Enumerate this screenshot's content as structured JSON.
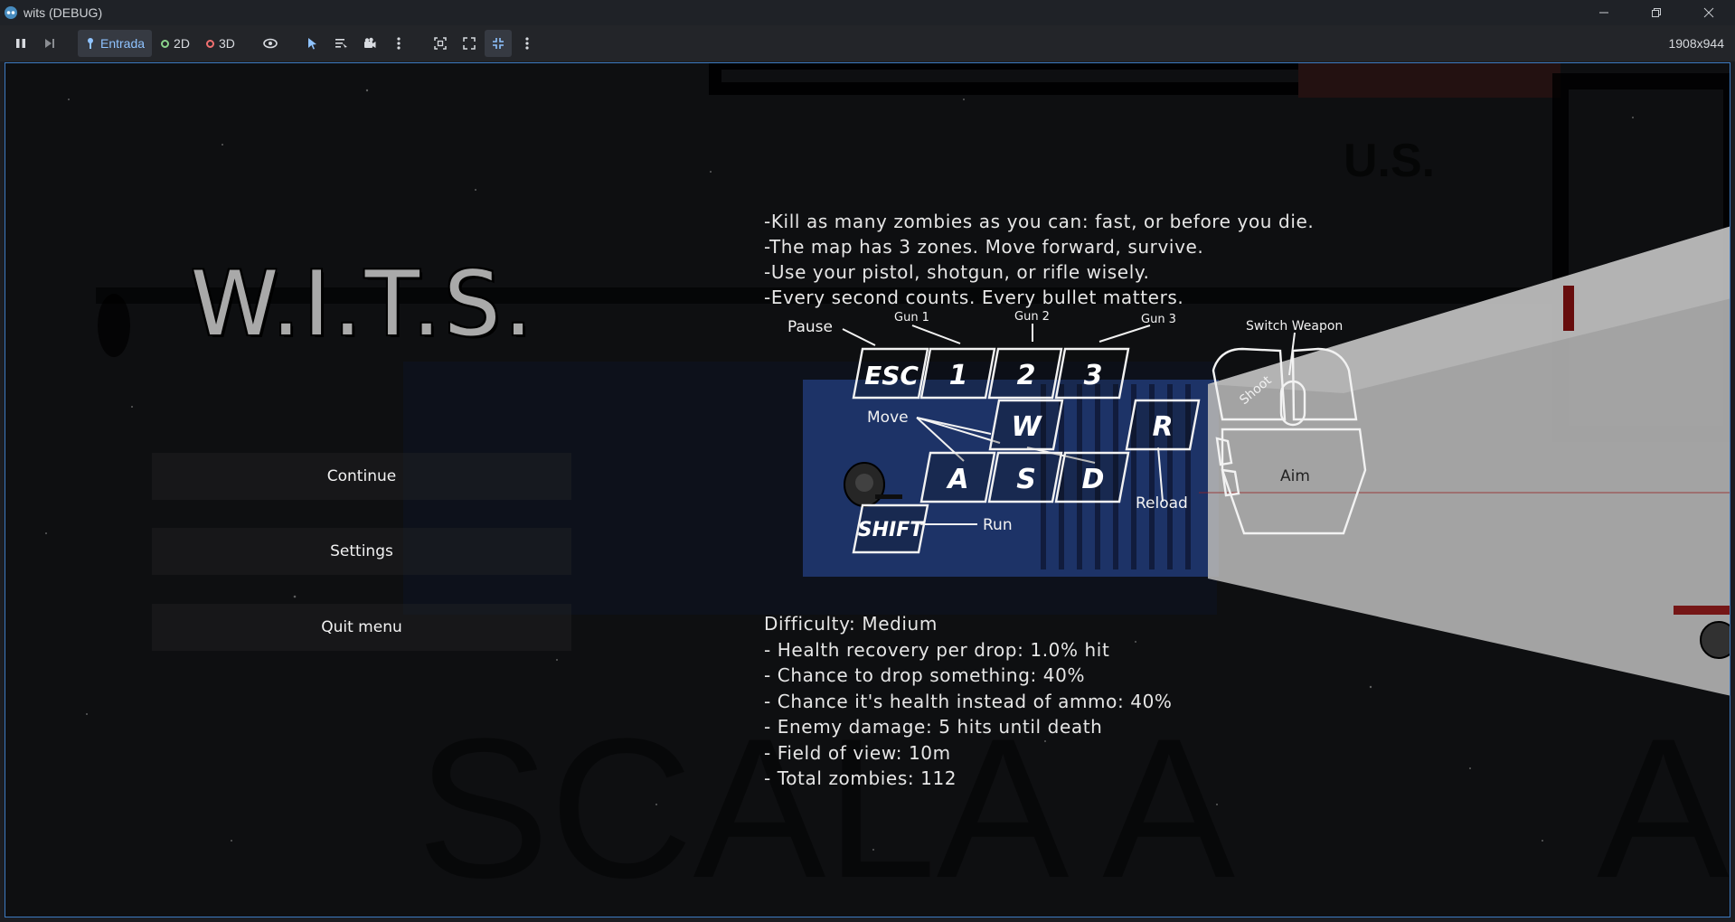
{
  "window": {
    "title": "wits (DEBUG)",
    "icon": "godot-icon",
    "controls": [
      "minimize-icon",
      "restore-icon",
      "close-icon"
    ]
  },
  "toolbar": {
    "pause_icon": "pause-icon",
    "next_frame_icon": "next-frame-icon",
    "tabs": [
      {
        "label": "Entrada",
        "icon": "input-icon",
        "active": true
      },
      {
        "label": "2D",
        "icon": "circle-2d-icon",
        "color": "#8bd48b"
      },
      {
        "label": "3D",
        "icon": "circle-3d-icon",
        "color": "#f07070"
      }
    ],
    "resolution": "1908x944"
  },
  "game": {
    "title": "W.I.T.S.",
    "menu": {
      "continue": "Continue",
      "settings": "Settings",
      "quit": "Quit menu"
    },
    "objectives": [
      "-Kill as many zombies as you can:  fast, or before you die.",
      "-The map has 3 zones. Move forward, survive.",
      "-Use your pistol, shotgun, or rifle wisely.",
      "-Every second counts. Every bullet matters."
    ],
    "controls": {
      "pause": "Pause",
      "gun1": "Gun 1",
      "gun2": "Gun 2",
      "gun3": "Gun 3",
      "switch_weapon": "Switch Weapon",
      "shoot": "Shoot",
      "aim": "Aim",
      "move": "Move",
      "reload": "Reload",
      "run": "Run",
      "keys": {
        "esc": "ESC",
        "one": "1",
        "two": "2",
        "three": "3",
        "w": "W",
        "a": "A",
        "s": "S",
        "d": "D",
        "r": "R",
        "shift": "SHIFT"
      }
    },
    "difficulty": [
      "Difficulty: Medium",
      "- Health recovery per drop: 1.0% hit",
      "- Chance to drop something: 40%",
      "- Chance it's health instead of ammo: 40%",
      "- Enemy damage: 5 hits until death",
      "- Field of view: 10m",
      "- Total zombies: 112"
    ],
    "background_texts": {
      "sign": "U.S.",
      "floor": "SCALA A",
      "floor2": "A"
    }
  }
}
